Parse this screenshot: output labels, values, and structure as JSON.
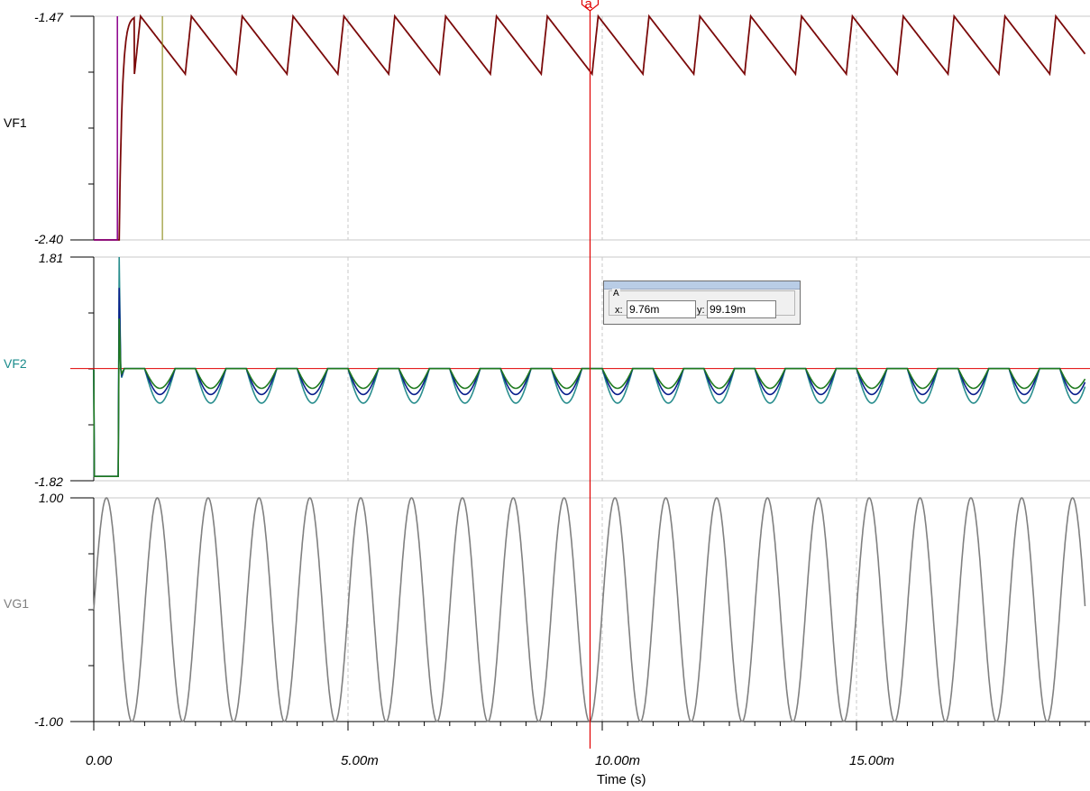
{
  "chart_data": [
    {
      "type": "line",
      "channel": "VF1",
      "ylim": [
        -2.4,
        -1.47
      ],
      "y_tick_labels": [
        "-1.47",
        "-2.40"
      ],
      "grid": true,
      "series": [
        {
          "color": "#7b0a0a",
          "description": "sawtooth ripple after startup",
          "t_start": 0.0005,
          "period": 0.001,
          "peak": -1.47,
          "trough": -1.71,
          "initial": -2.4
        },
        {
          "color": "#8b008b",
          "description": "startup step",
          "t": 0.0005,
          "from": -2.4,
          "to": -1.47
        },
        {
          "color": "#808000",
          "description": "vertical marker",
          "t": 0.00135,
          "from": -2.4,
          "to": -1.47
        }
      ]
    },
    {
      "type": "line",
      "channel": "VF2",
      "ylim": [
        -1.82,
        1.81
      ],
      "y_tick_labels": [
        "1.81",
        "-1.82"
      ],
      "grid": true,
      "reference_level": 0.0,
      "series": [
        {
          "color": "#2a8e8e",
          "description": "deepest dips",
          "dip_depth": -0.56
        },
        {
          "color": "#0a1e8c",
          "description": "middle dips",
          "dip_depth": -0.42
        },
        {
          "color": "#1f7a1f",
          "description": "shallow dips",
          "dip_depth": -0.32
        }
      ],
      "startup_low": -1.75
    },
    {
      "type": "line",
      "channel": "VG1",
      "ylim": [
        -1.0,
        1.0
      ],
      "y_tick_labels": [
        "1.00",
        "-1.00"
      ],
      "grid": true,
      "series": [
        {
          "color": "#808080",
          "description": "sine wave",
          "amplitude": 1.0,
          "period": 0.001
        }
      ]
    }
  ],
  "x_axis": {
    "xlim": [
      0,
      0.0195
    ],
    "tick_labels": [
      "0.00",
      "5.00m",
      "10.00m",
      "15.00m"
    ],
    "tick_values": [
      0,
      0.005,
      0.01,
      0.015
    ],
    "label": "Time (s)"
  },
  "channels": {
    "vf1": {
      "label": "VF1",
      "color": "#000000"
    },
    "vf2": {
      "label": "VF2",
      "color": "#1a8b8b"
    },
    "vg1": {
      "label": "VG1",
      "color": "#808080"
    }
  },
  "cursor": {
    "marker_label": "a",
    "color": "#e00000",
    "time": 0.00976,
    "readout": {
      "group": "A",
      "x_label": "x:",
      "x_value": "9.76m",
      "y_label": "y:",
      "y_value": "99.19m"
    }
  }
}
